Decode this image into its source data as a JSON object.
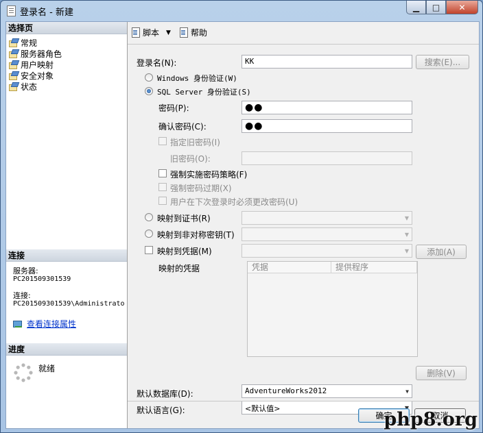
{
  "window": {
    "title": "登录名 - 新建"
  },
  "left": {
    "select_page_header": "选择页",
    "pages": [
      "常规",
      "服务器角色",
      "用户映射",
      "安全对象",
      "状态"
    ],
    "connection_header": "连接",
    "server_label": "服务器:",
    "server_value": "PC201509301539",
    "connection_label": "连接:",
    "connection_value": "PC201509301539\\Administrato",
    "view_props_link": "查看连接属性",
    "progress_header": "进度",
    "progress_status": "就绪"
  },
  "toolbar": {
    "script_label": "脚本",
    "help_label": "帮助"
  },
  "form": {
    "login_name_label": "登录名(N):",
    "login_name_value": "KK",
    "search_button": "搜索(E)...",
    "windows_auth_label": "Windows 身份验证(W)",
    "sql_auth_label": "SQL Server 身份验证(S)",
    "password_label": "密码(P):",
    "password_mask": "●●",
    "confirm_password_label": "确认密码(C):",
    "confirm_password_mask": "●●",
    "specify_old_password_label": "指定旧密码(I)",
    "old_password_label": "旧密码(O):",
    "enforce_policy_label": "强制实施密码策略(F)",
    "enforce_expiration_label": "强制密码过期(X)",
    "must_change_label": "用户在下次登录时必须更改密码(U)",
    "map_cert_label": "映射到证书(R)",
    "map_asym_key_label": "映射到非对称密钥(T)",
    "map_credential_label": "映射到凭据(M)",
    "add_button": "添加(A)",
    "mapped_credentials_label": "映射的凭据",
    "grid_headers": [
      "凭据",
      "提供程序"
    ],
    "remove_button": "删除(V)",
    "default_db_label": "默认数据库(D):",
    "default_db_value": "AdventureWorks2012",
    "default_lang_label": "默认语言(G):",
    "default_lang_value": "<默认值>"
  },
  "footer": {
    "ok_button": "确定",
    "cancel_button": "取消"
  },
  "watermark": "php8.org"
}
